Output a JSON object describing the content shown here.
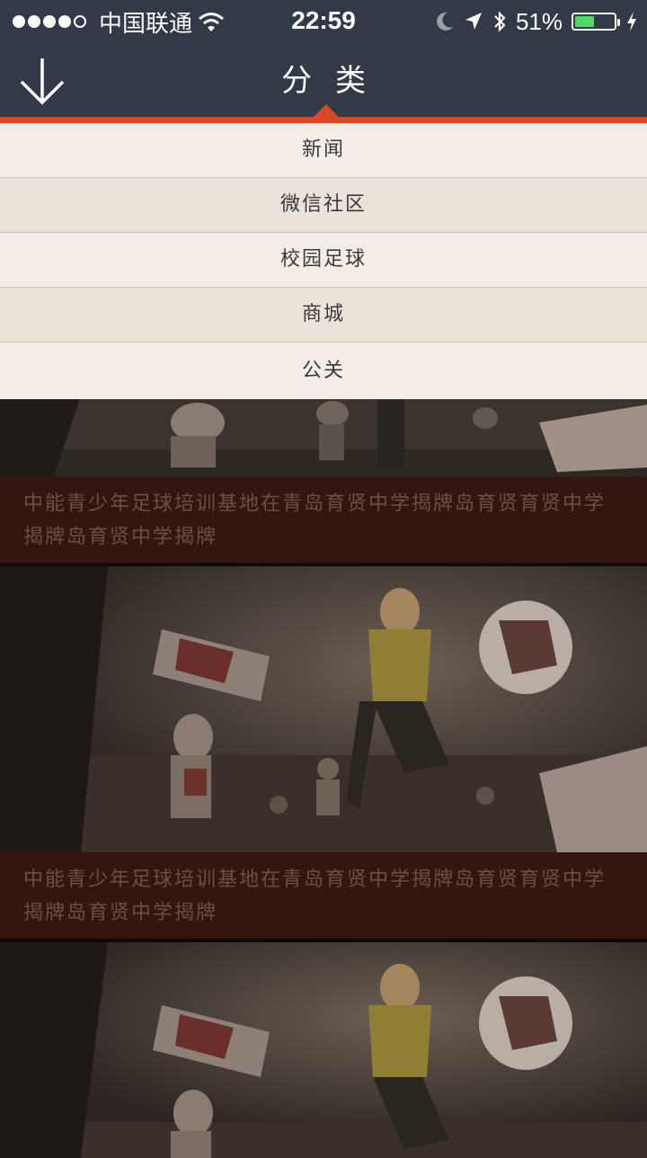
{
  "status_bar": {
    "carrier": "中国联通",
    "time": "22:59",
    "battery": "51%",
    "battery_level": 0.51,
    "icons": [
      "signal-dots",
      "wifi-icon",
      "moon-icon",
      "location-arrow-icon",
      "bluetooth-icon",
      "battery-icon",
      "charging-bolt-icon"
    ]
  },
  "navbar": {
    "title": "分类",
    "back_icon": "down-arrow-icon"
  },
  "menu": {
    "items": [
      {
        "label": "新闻"
      },
      {
        "label": "微信社区"
      },
      {
        "label": "校园足球"
      },
      {
        "label": "商城"
      },
      {
        "label": "公关"
      }
    ]
  },
  "feed": {
    "items": [
      {
        "caption": "中能青少年足球培训基地在青岛育贤中学揭牌岛育贤育贤中学揭牌岛育贤中学揭牌"
      },
      {
        "caption": "中能青少年足球培训基地在青岛育贤中学揭牌岛育贤育贤中学揭牌岛育贤中学揭牌"
      }
    ]
  },
  "colors": {
    "bar_bg": "#323a48",
    "accent": "#d84a26",
    "menu_bg_light": "#f4ede7",
    "menu_bg_dark": "#ebe2d9",
    "caption_bg": "#34150f",
    "caption_text": "#6b5046"
  }
}
